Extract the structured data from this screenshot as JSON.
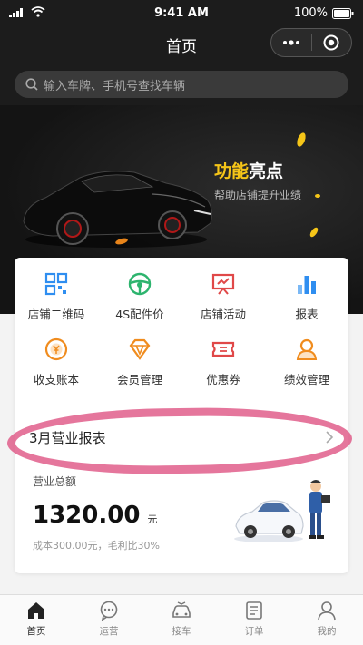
{
  "status_bar": {
    "time": "9:41 AM",
    "battery": "100%"
  },
  "nav": {
    "title": "首页"
  },
  "search": {
    "placeholder": "输入车牌、手机号查找车辆"
  },
  "banner": {
    "title_highlight": "功能",
    "title_rest": "亮点",
    "subtitle": "帮助店铺提升业绩"
  },
  "grid": [
    {
      "label": "店铺二维码",
      "icon": "qrcode-icon",
      "color": "#2f8ef0"
    },
    {
      "label": "4S配件价",
      "icon": "steering-wheel-icon",
      "color": "#2db46e"
    },
    {
      "label": "店铺活动",
      "icon": "presentation-board-icon",
      "color": "#e04848"
    },
    {
      "label": "报表",
      "icon": "bar-chart-icon",
      "color": "#2f8ef0"
    },
    {
      "label": "收支账本",
      "icon": "yen-coin-icon",
      "color": "#f08c1e"
    },
    {
      "label": "会员管理",
      "icon": "diamond-icon",
      "color": "#f08c1e"
    },
    {
      "label": "优惠券",
      "icon": "ticket-icon",
      "color": "#e04848"
    },
    {
      "label": "绩效管理",
      "icon": "user-badge-icon",
      "color": "#f08c1e"
    }
  ],
  "report": {
    "title": "3月营业报表",
    "total_label": "营业总额",
    "total_amount": "1320.00",
    "currency_unit": "元",
    "detail": "成本300.00元，毛利比30%"
  },
  "tabs": [
    {
      "label": "首页",
      "icon": "home-icon",
      "active": true
    },
    {
      "label": "运营",
      "icon": "chat-bubble-icon",
      "active": false
    },
    {
      "label": "接车",
      "icon": "car-pickup-icon",
      "active": false
    },
    {
      "label": "订单",
      "icon": "order-list-icon",
      "active": false
    },
    {
      "label": "我的",
      "icon": "user-icon",
      "active": false
    }
  ],
  "colors": {
    "header_bg": "#1c1c1c",
    "highlight_yellow": "#f5c518",
    "annotation_pink": "#de5080"
  }
}
